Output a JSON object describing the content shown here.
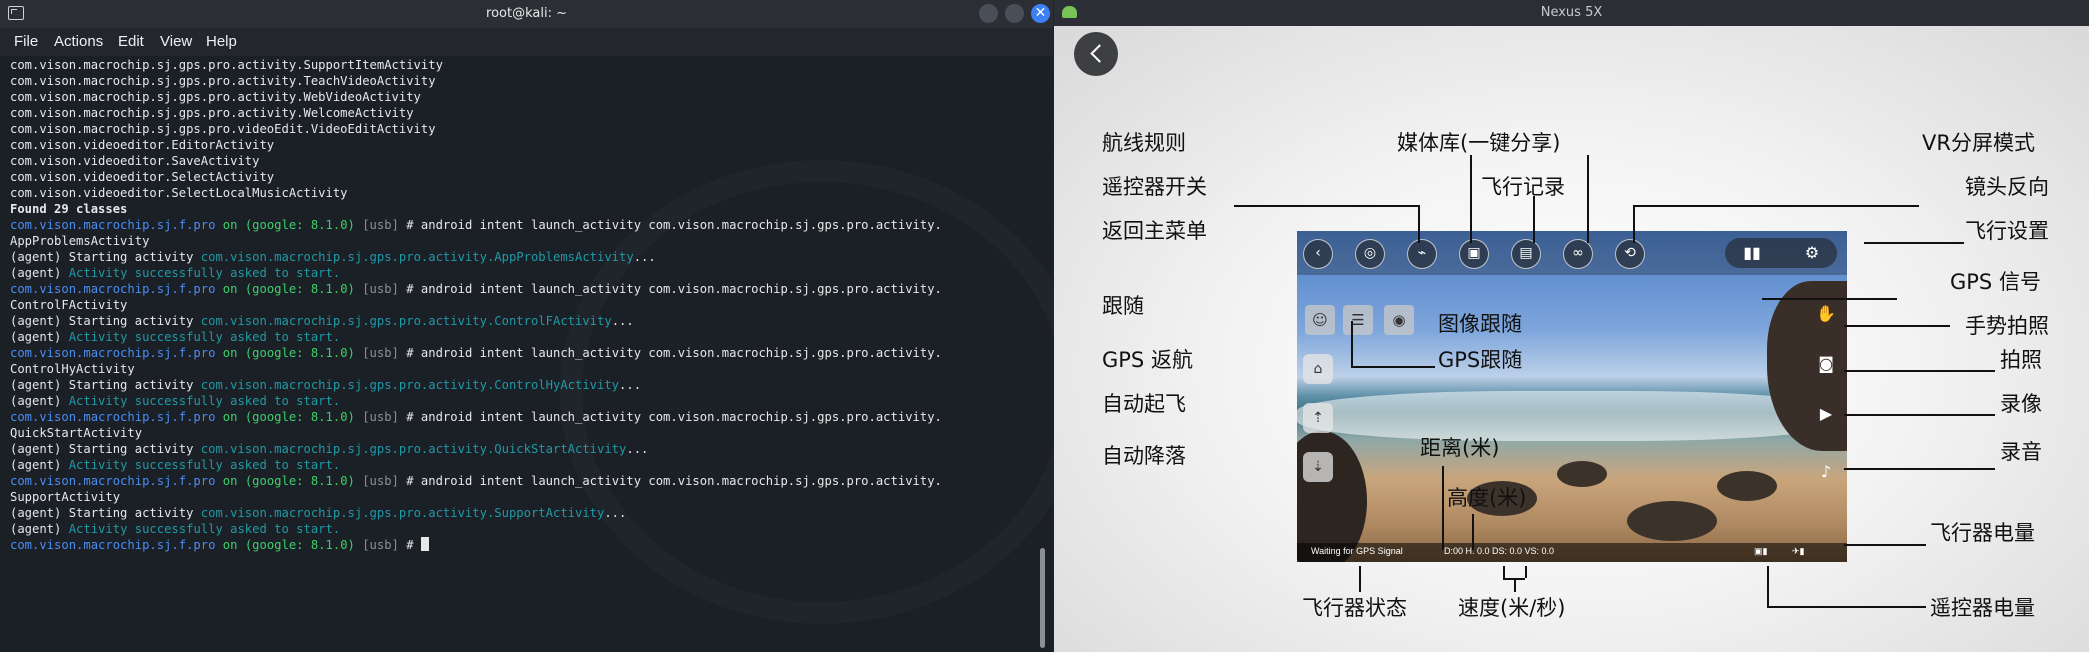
{
  "terminal": {
    "title": "root@kali: ~",
    "close_glyph": "✕",
    "menu": [
      "File",
      "Actions",
      "Edit",
      "View",
      "Help"
    ],
    "lines": [
      [
        {
          "t": "com.vison.macrochip.sj.gps.pro.activity.SupportItemActivity",
          "c": "white"
        }
      ],
      [
        {
          "t": "com.vison.macrochip.sj.gps.pro.activity.TeachVideoActivity",
          "c": "white"
        }
      ],
      [
        {
          "t": "com.vison.macrochip.sj.gps.pro.activity.WebVideoActivity",
          "c": "white"
        }
      ],
      [
        {
          "t": "com.vison.macrochip.sj.gps.pro.activity.WelcomeActivity",
          "c": "white"
        }
      ],
      [
        {
          "t": "com.vison.macrochip.sj.gps.pro.videoEdit.VideoEditActivity",
          "c": "white"
        }
      ],
      [
        {
          "t": "com.vison.videoeditor.EditorActivity",
          "c": "white"
        }
      ],
      [
        {
          "t": "com.vison.videoeditor.SaveActivity",
          "c": "white"
        }
      ],
      [
        {
          "t": "com.vison.videoeditor.SelectActivity",
          "c": "white"
        }
      ],
      [
        {
          "t": "com.vison.videoeditor.SelectLocalMusicActivity",
          "c": "white"
        }
      ],
      [
        {
          "t": "",
          "c": "white"
        }
      ],
      [
        {
          "t": "Found 29 classes",
          "c": "white bold"
        }
      ],
      [
        {
          "t": "com.vison.macrochip.sj.f.pro",
          "c": "blue"
        },
        {
          "t": " on ",
          "c": "green"
        },
        {
          "t": "(google: 8.1.0)",
          "c": "green"
        },
        {
          "t": " [usb]",
          "c": "grey"
        },
        {
          "t": " # android intent launch_activity com.vison.macrochip.sj.gps.pro.activity.",
          "c": "white"
        }
      ],
      [
        {
          "t": "AppProblemsActivity",
          "c": "white"
        }
      ],
      [
        {
          "t": "",
          "c": "white"
        }
      ],
      [
        {
          "t": "(agent) Starting activity ",
          "c": "white"
        },
        {
          "t": "com.vison.macrochip.sj.gps.pro.activity.AppProblemsActivity",
          "c": "teal"
        },
        {
          "t": "...",
          "c": "white"
        }
      ],
      [
        {
          "t": "(agent) ",
          "c": "white"
        },
        {
          "t": "Activity successfully asked to start.",
          "c": "teal"
        }
      ],
      [
        {
          "t": "com.vison.macrochip.sj.f.pro",
          "c": "blue"
        },
        {
          "t": " on ",
          "c": "green"
        },
        {
          "t": "(google: 8.1.0)",
          "c": "green"
        },
        {
          "t": " [usb]",
          "c": "grey"
        },
        {
          "t": " # android intent launch_activity com.vison.macrochip.sj.gps.pro.activity.",
          "c": "white"
        }
      ],
      [
        {
          "t": "ControlFActivity",
          "c": "white"
        }
      ],
      [
        {
          "t": "(agent) Starting activity ",
          "c": "white"
        },
        {
          "t": "com.vison.macrochip.sj.gps.pro.activity.ControlFActivity",
          "c": "teal"
        },
        {
          "t": "...",
          "c": "white"
        }
      ],
      [
        {
          "t": "(agent) ",
          "c": "white"
        },
        {
          "t": "Activity successfully asked to start.",
          "c": "teal"
        }
      ],
      [
        {
          "t": "com.vison.macrochip.sj.f.pro",
          "c": "blue"
        },
        {
          "t": " on ",
          "c": "green"
        },
        {
          "t": "(google: 8.1.0)",
          "c": "green"
        },
        {
          "t": " [usb]",
          "c": "grey"
        },
        {
          "t": " # android intent launch_activity com.vison.macrochip.sj.gps.pro.activity.",
          "c": "white"
        }
      ],
      [
        {
          "t": "ControlHyActivity",
          "c": "white"
        }
      ],
      [
        {
          "t": "(agent) Starting activity ",
          "c": "white"
        },
        {
          "t": "com.vison.macrochip.sj.gps.pro.activity.ControlHyActivity",
          "c": "teal"
        },
        {
          "t": "...",
          "c": "white"
        }
      ],
      [
        {
          "t": "(agent) ",
          "c": "white"
        },
        {
          "t": "Activity successfully asked to start.",
          "c": "teal"
        }
      ],
      [
        {
          "t": "com.vison.macrochip.sj.f.pro",
          "c": "blue"
        },
        {
          "t": " on ",
          "c": "green"
        },
        {
          "t": "(google: 8.1.0)",
          "c": "green"
        },
        {
          "t": " [usb]",
          "c": "grey"
        },
        {
          "t": " # android intent launch_activity com.vison.macrochip.sj.gps.pro.activity.",
          "c": "white"
        }
      ],
      [
        {
          "t": "QuickStartActivity",
          "c": "white"
        }
      ],
      [
        {
          "t": "(agent) Starting activity ",
          "c": "white"
        },
        {
          "t": "com.vison.macrochip.sj.gps.pro.activity.QuickStartActivity",
          "c": "teal"
        },
        {
          "t": "...",
          "c": "white"
        }
      ],
      [
        {
          "t": "(agent) ",
          "c": "white"
        },
        {
          "t": "Activity successfully asked to start.",
          "c": "teal"
        }
      ],
      [
        {
          "t": "com.vison.macrochip.sj.f.pro",
          "c": "blue"
        },
        {
          "t": " on ",
          "c": "green"
        },
        {
          "t": "(google: 8.1.0)",
          "c": "green"
        },
        {
          "t": " [usb]",
          "c": "grey"
        },
        {
          "t": " # android intent launch_activity com.vison.macrochip.sj.gps.pro.activity.",
          "c": "white"
        }
      ],
      [
        {
          "t": "SupportActivity",
          "c": "white"
        }
      ],
      [
        {
          "t": "(agent) Starting activity ",
          "c": "white"
        },
        {
          "t": "com.vison.macrochip.sj.gps.pro.activity.SupportActivity",
          "c": "teal"
        },
        {
          "t": "...",
          "c": "white"
        }
      ],
      [
        {
          "t": "(agent) ",
          "c": "white"
        },
        {
          "t": "Activity successfully asked to start.",
          "c": "teal"
        }
      ],
      [
        {
          "t": "com.vison.macrochip.sj.f.pro",
          "c": "blue"
        },
        {
          "t": " on ",
          "c": "green"
        },
        {
          "t": "(google: 8.1.0)",
          "c": "green"
        },
        {
          "t": " [usb]",
          "c": "grey"
        },
        {
          "t": " # ",
          "c": "white"
        }
      ]
    ]
  },
  "emulator": {
    "title": "Nexus 5X",
    "labels": {
      "route_planning": "航线规则",
      "media_library": "媒体库(一键分享)",
      "vr_mode": "VR分屏模式",
      "remote_switch": "遥控器开关",
      "flight_record": "飞行记录",
      "lens_reverse": "镜头反向",
      "main_menu": "返回主菜单",
      "flight_settings": "飞行设置",
      "follow": "跟随",
      "image_follow": "图像跟随",
      "gps_signal": "GPS 信号",
      "gesture_photo": "手势拍照",
      "gps_return": "GPS 返航",
      "gps_follow": "GPS跟随",
      "photo": "拍照",
      "auto_takeoff": "自动起飞",
      "video": "录像",
      "distance": "距离(米)",
      "auto_land": "自动降落",
      "audio": "录音",
      "height": "高度(米)",
      "aircraft_battery": "飞行器电量",
      "flight_status": "飞行器状态",
      "speed": "速度(米/秒)",
      "remote_battery": "遥控器电量"
    },
    "hud": {
      "status_text": "Waiting for GPS Signal",
      "telemetry": "D:00 H: 0.0 DS: 0.0 VS: 0.0"
    }
  }
}
